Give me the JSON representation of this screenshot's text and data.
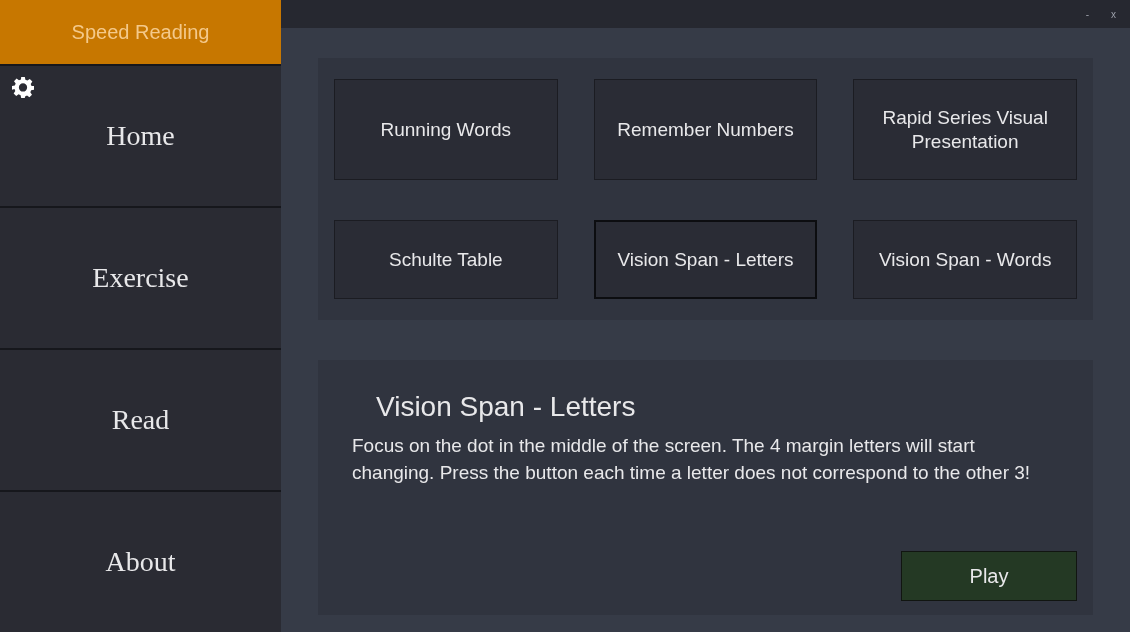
{
  "app_title": "Speed Reading",
  "window_controls": [
    "-",
    "x"
  ],
  "nav": [
    {
      "label": "Home"
    },
    {
      "label": "Exercise"
    },
    {
      "label": "Read"
    },
    {
      "label": "About"
    }
  ],
  "exercises": [
    {
      "label": "Running Words",
      "selected": false
    },
    {
      "label": "Remember Numbers",
      "selected": false
    },
    {
      "label": "Rapid Series Visual Presentation",
      "selected": false
    },
    {
      "label": "Schulte Table",
      "selected": false
    },
    {
      "label": "Vision Span - Letters",
      "selected": true
    },
    {
      "label": "Vision Span - Words",
      "selected": false
    }
  ],
  "detail": {
    "title": "Vision Span - Letters",
    "description": "Focus on the dot in the middle of the screen. The 4 margin letters will start changing. Press the button each time a letter does not correspond to the other 3!",
    "button": "Play"
  }
}
